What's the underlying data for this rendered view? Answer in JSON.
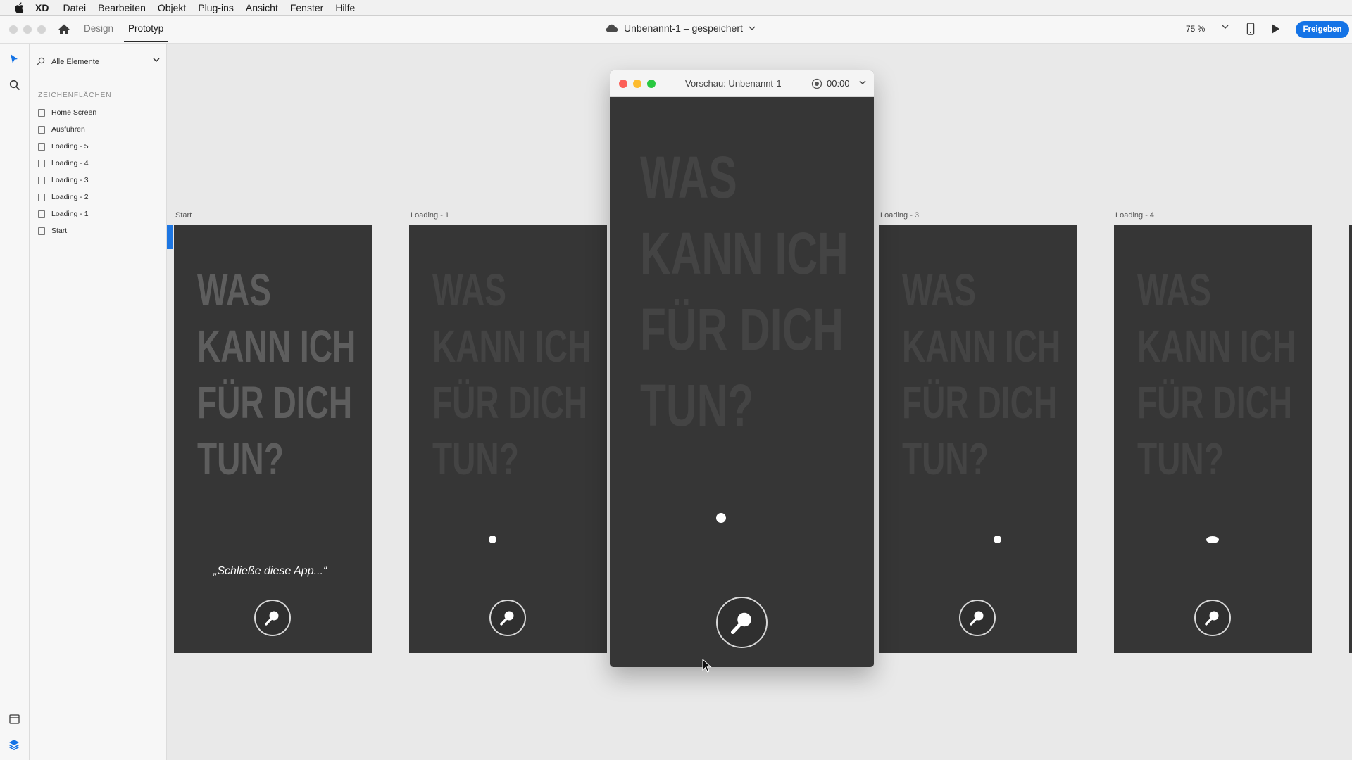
{
  "menubar": {
    "app_name": "XD",
    "items": [
      "Datei",
      "Bearbeiten",
      "Objekt",
      "Plug-ins",
      "Ansicht",
      "Fenster",
      "Hilfe"
    ]
  },
  "toolbar": {
    "mode_tabs": [
      "Design",
      "Prototyp"
    ],
    "active_tab": "Prototyp",
    "doc_title": "Unbenannt-1 – gespeichert",
    "zoom": "75 %",
    "share_label": "Freigeben"
  },
  "layers": {
    "filter_label": "Alle Elemente",
    "section_title": "ZEICHENFLÄCHEN",
    "items": [
      "Home Screen",
      "Ausführen",
      "Loading - 5",
      "Loading - 4",
      "Loading - 3",
      "Loading - 2",
      "Loading - 1",
      "Start"
    ]
  },
  "artboards": {
    "start": {
      "label": "Start",
      "quote": "„Schließe diese App...“"
    },
    "loading1": {
      "label": "Loading - 1"
    },
    "loading3": {
      "label": "Loading - 3"
    },
    "loading4": {
      "label": "Loading - 4"
    },
    "headline_lines": [
      "WAS",
      "KANN ICH",
      "FÜR DICH",
      "TUN?"
    ]
  },
  "preview": {
    "title": "Vorschau: Unbenannt-1",
    "time": "00:00"
  },
  "colors": {
    "accent": "#1473e6",
    "artboard_bg": "#363636",
    "canvas_bg": "#e9e9e9"
  }
}
